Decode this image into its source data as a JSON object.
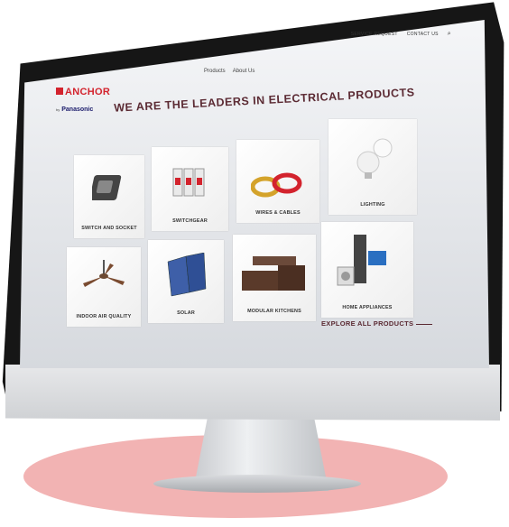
{
  "header": {
    "top_links": [
      "SERVICE REQUEST",
      "CONTACT US"
    ],
    "search_icon": "search-icon",
    "main_nav": [
      "Products",
      "About Us"
    ]
  },
  "logo": {
    "brand": "ANCHOR",
    "by": "by",
    "partner": "Panasonic"
  },
  "hero": {
    "title": "WE ARE THE LEADERS IN ELECTRICAL PRODUCTS"
  },
  "categories": [
    {
      "label": "SWITCH AND SOCKET",
      "icon": "switch-icon"
    },
    {
      "label": "SWITCHGEAR",
      "icon": "switchgear-icon"
    },
    {
      "label": "WIRES & CABLES",
      "icon": "cable-icon"
    },
    {
      "label": "LIGHTING",
      "icon": "bulb-icon"
    },
    {
      "label": "INDOOR AIR QUALITY",
      "icon": "fan-icon"
    },
    {
      "label": "SOLAR",
      "icon": "solar-panel-icon"
    },
    {
      "label": "MODULAR KITCHENS",
      "icon": "kitchen-icon"
    },
    {
      "label": "HOME APPLIANCES",
      "icon": "appliance-icon"
    }
  ],
  "cta": {
    "explore": "EXPLORE ALL PRODUCTS"
  },
  "colors": {
    "brand_red": "#d3232d",
    "headline": "#5b2a33",
    "base": "#f2b3b3"
  }
}
